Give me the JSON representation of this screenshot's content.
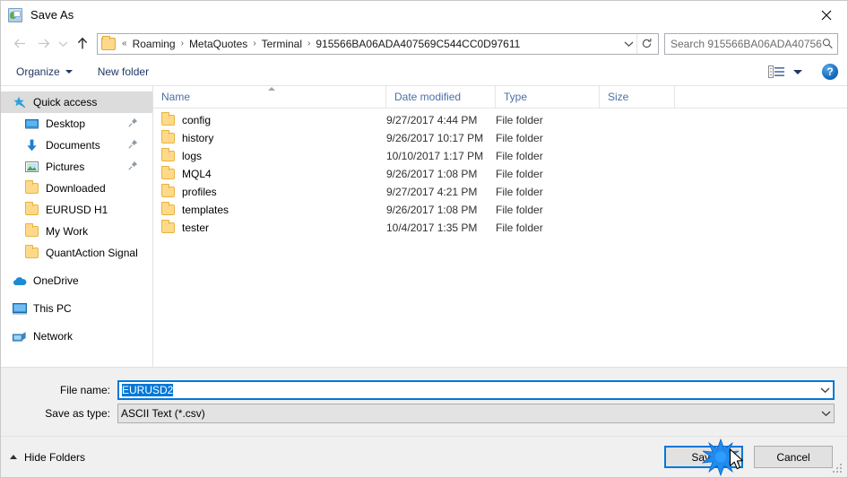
{
  "window": {
    "title": "Save As",
    "close_label": "✕"
  },
  "nav": {
    "back_icon": "back-arrow-icon",
    "forward_icon": "forward-arrow-icon",
    "recent_icon": "chevron-down-icon",
    "up_icon": "up-arrow-icon",
    "refresh_icon": "refresh-icon",
    "breadcrumb_prefix": "«",
    "breadcrumbs": [
      "Roaming",
      "MetaQuotes",
      "Terminal",
      "915566BA06ADA407569C544CC0D97611"
    ],
    "breadcrumb_separator": "›"
  },
  "search": {
    "placeholder": "Search 915566BA06ADA40756...",
    "icon": "search-icon"
  },
  "toolbar": {
    "organize_label": "Organize",
    "new_folder_label": "New folder",
    "view_icon": "view-layout-icon",
    "view_caret_icon": "chevron-down-icon",
    "help_label": "?"
  },
  "sidebar": {
    "items": [
      {
        "label": "Quick access",
        "icon": "star-pin-icon",
        "level": 1,
        "selected": true,
        "pinned": false
      },
      {
        "label": "Desktop",
        "icon": "desktop-icon",
        "level": 2,
        "selected": false,
        "pinned": true
      },
      {
        "label": "Documents",
        "icon": "documents-icon",
        "level": 2,
        "selected": false,
        "pinned": true
      },
      {
        "label": "Pictures",
        "icon": "pictures-icon",
        "level": 2,
        "selected": false,
        "pinned": true
      },
      {
        "label": "Downloaded",
        "icon": "folder-icon",
        "level": 2,
        "selected": false,
        "pinned": false
      },
      {
        "label": "EURUSD H1",
        "icon": "folder-icon",
        "level": 2,
        "selected": false,
        "pinned": false
      },
      {
        "label": "My Work",
        "icon": "folder-icon",
        "level": 2,
        "selected": false,
        "pinned": false
      },
      {
        "label": "QuantAction Signal",
        "icon": "folder-icon",
        "level": 2,
        "selected": false,
        "pinned": false
      },
      {
        "label": "OneDrive",
        "icon": "onedrive-icon",
        "level": 1,
        "selected": false,
        "pinned": false,
        "group": true
      },
      {
        "label": "This PC",
        "icon": "this-pc-icon",
        "level": 1,
        "selected": false,
        "pinned": false,
        "group": true
      },
      {
        "label": "Network",
        "icon": "network-icon",
        "level": 1,
        "selected": false,
        "pinned": false,
        "group": true
      }
    ]
  },
  "filelist": {
    "columns": [
      "Name",
      "Date modified",
      "Type",
      "Size"
    ],
    "sort_column": "Name",
    "sort_direction": "ascending",
    "rows": [
      {
        "name": "config",
        "date": "9/27/2017 4:44 PM",
        "type": "File folder",
        "size": ""
      },
      {
        "name": "history",
        "date": "9/26/2017 10:17 PM",
        "type": "File folder",
        "size": ""
      },
      {
        "name": "logs",
        "date": "10/10/2017 1:17 PM",
        "type": "File folder",
        "size": ""
      },
      {
        "name": "MQL4",
        "date": "9/26/2017 1:08 PM",
        "type": "File folder",
        "size": ""
      },
      {
        "name": "profiles",
        "date": "9/27/2017 4:21 PM",
        "type": "File folder",
        "size": ""
      },
      {
        "name": "templates",
        "date": "9/26/2017 1:08 PM",
        "type": "File folder",
        "size": ""
      },
      {
        "name": "tester",
        "date": "10/4/2017 1:35 PM",
        "type": "File folder",
        "size": ""
      }
    ]
  },
  "form": {
    "filename_label": "File name:",
    "filename_value": "EURUSD2",
    "filename_selected": true,
    "savetype_label": "Save as type:",
    "savetype_value": "ASCII Text (*.csv)"
  },
  "footer": {
    "hide_folders_label": "Hide Folders",
    "save_label": "Save",
    "cancel_label": "Cancel"
  },
  "colors": {
    "accent": "#0078d7",
    "folder": "#ffd98a",
    "header_text": "#4b6fa8",
    "toolbar_text": "#1f3864"
  }
}
